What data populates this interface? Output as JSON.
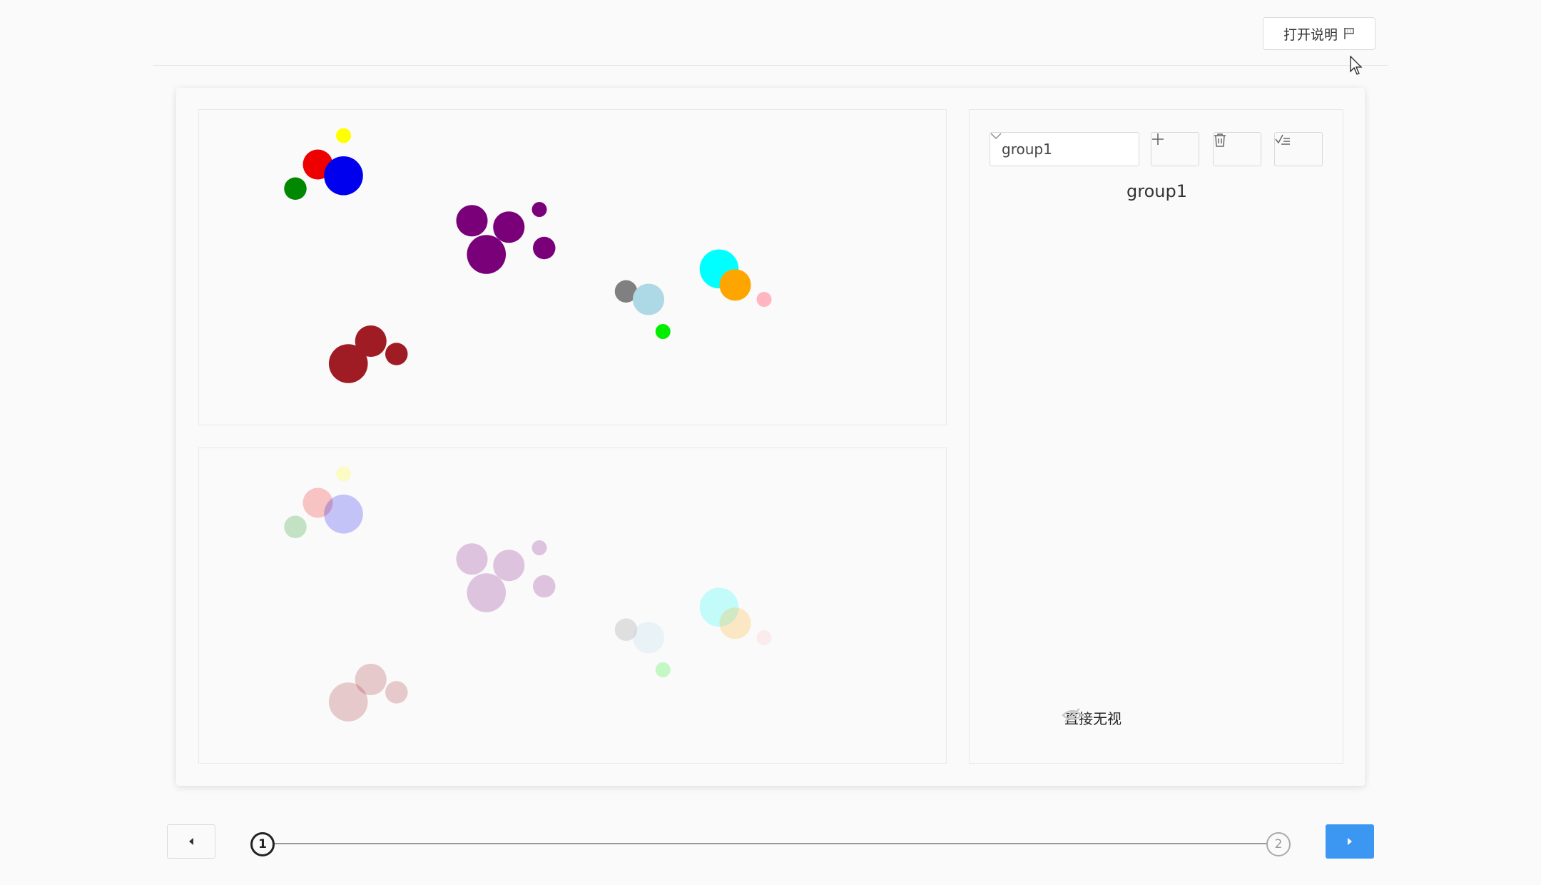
{
  "header": {
    "help_button_label": "打开说明"
  },
  "sidebar": {
    "group_select_value": "group1",
    "group_title": "group1",
    "visibility_label": "直接无视"
  },
  "stepper": {
    "steps": [
      "1",
      "2"
    ],
    "current_step": "1"
  },
  "colors": {
    "accent": "#3b97f2",
    "yellow": "#ffff00",
    "red": "#ee0000",
    "blue": "#0000ee",
    "green": "#008800",
    "purple": "#7a007a",
    "gray": "#808080",
    "lightblue": "#add8e6",
    "lime": "#00ee00",
    "cyan": "#00ffff",
    "orange": "#ffa500",
    "pink": "#ffb6c1",
    "darkred": "#a01c25"
  },
  "scatter_points": [
    {
      "color": "yellow",
      "x": 9.0,
      "y": 1.6,
      "r": 1.0
    },
    {
      "color": "red",
      "x": 7.4,
      "y": 3.4,
      "r": 2.0
    },
    {
      "color": "blue",
      "x": 9.0,
      "y": 4.1,
      "r": 2.6
    },
    {
      "color": "green",
      "x": 6.0,
      "y": 4.9,
      "r": 1.5
    },
    {
      "color": "purple",
      "x": 17.0,
      "y": 6.9,
      "r": 2.1
    },
    {
      "color": "purple",
      "x": 19.3,
      "y": 7.3,
      "r": 2.1
    },
    {
      "color": "purple",
      "x": 21.2,
      "y": 6.2,
      "r": 1.0
    },
    {
      "color": "purple",
      "x": 17.9,
      "y": 9.0,
      "r": 2.6
    },
    {
      "color": "purple",
      "x": 21.5,
      "y": 8.6,
      "r": 1.5
    },
    {
      "color": "gray",
      "x": 26.6,
      "y": 11.3,
      "r": 1.5
    },
    {
      "color": "lightblue",
      "x": 28.0,
      "y": 11.8,
      "r": 2.1
    },
    {
      "color": "lime",
      "x": 28.9,
      "y": 13.8,
      "r": 1.0
    },
    {
      "color": "cyan",
      "x": 32.4,
      "y": 9.9,
      "r": 2.6
    },
    {
      "color": "orange",
      "x": 33.4,
      "y": 10.9,
      "r": 2.1
    },
    {
      "color": "pink",
      "x": 35.2,
      "y": 11.8,
      "r": 1.0
    },
    {
      "color": "darkred",
      "x": 10.7,
      "y": 14.4,
      "r": 2.1
    },
    {
      "color": "darkred",
      "x": 9.3,
      "y": 15.8,
      "r": 2.6
    },
    {
      "color": "darkred",
      "x": 12.3,
      "y": 15.2,
      "r": 1.5
    }
  ],
  "panels": {
    "top_opacity": 1.0,
    "bottom_opacity": 0.22
  }
}
